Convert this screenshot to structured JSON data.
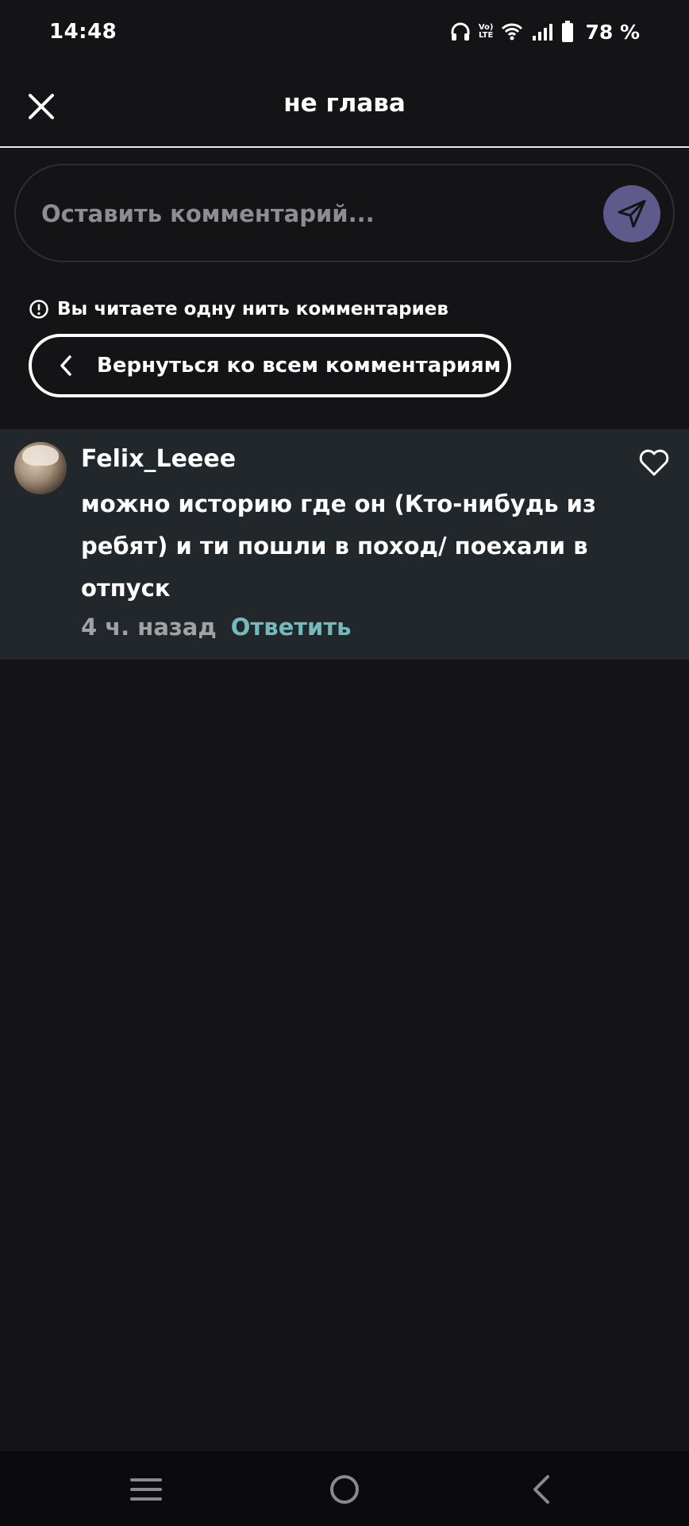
{
  "status_bar": {
    "time": "14:48",
    "network_badge_top": "Vo)",
    "network_badge_bottom": "LTE",
    "battery_percent": "78 %"
  },
  "header": {
    "title": "не глава"
  },
  "comment_input": {
    "placeholder": "Оставить комментарий..."
  },
  "thread": {
    "note": "Вы читаете одну нить комментариев",
    "back_button_label": "Вернуться ко всем комментариям"
  },
  "comment": {
    "author": "Felix_Leeee",
    "text": "можно историю где он (Кто-нибудь из ребят) и ти пошли в поход/ поехали в отпуск",
    "time": "4 ч. назад",
    "reply_label": "Ответить"
  },
  "colors": {
    "background": "#141316",
    "comment_card": "#22272b",
    "send_button": "#5e5a8c",
    "reply_link": "#74b9bd"
  },
  "icons": [
    "headphones-icon",
    "volte-icon",
    "wifi-icon",
    "signal-icon",
    "battery-icon",
    "close-icon",
    "send-icon",
    "info-icon",
    "chevron-left-icon",
    "heart-icon",
    "menu-icon",
    "home-icon",
    "back-icon"
  ]
}
